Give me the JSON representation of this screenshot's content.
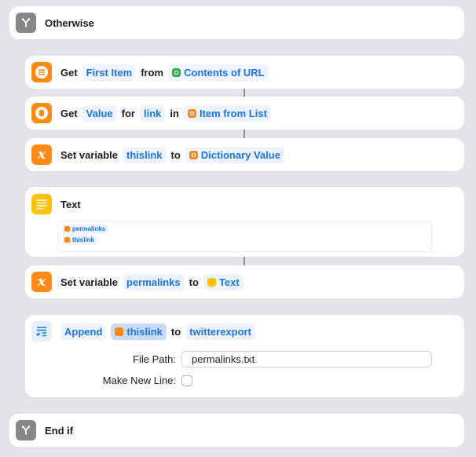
{
  "otherwise": {
    "label": "Otherwise",
    "icon": "branch-icon"
  },
  "actions": [
    {
      "icon": "list-icon",
      "parts": [
        {
          "type": "word",
          "text": "Get"
        },
        {
          "type": "token",
          "text": "First Item"
        },
        {
          "type": "word",
          "text": "from"
        },
        {
          "type": "token",
          "text": "Contents of URL",
          "icon": "url-icon",
          "icon_color": "#2fb24c"
        }
      ]
    },
    {
      "icon": "dictionary-icon",
      "parts": [
        {
          "type": "word",
          "text": "Get"
        },
        {
          "type": "token",
          "text": "Value"
        },
        {
          "type": "word",
          "text": "for"
        },
        {
          "type": "token",
          "text": "link"
        },
        {
          "type": "word",
          "text": "in"
        },
        {
          "type": "token",
          "text": "Item from List",
          "icon": "list-variable-icon",
          "icon_color": "#fd8a14"
        }
      ]
    },
    {
      "icon": "variable-icon",
      "parts": [
        {
          "type": "word",
          "text": "Set variable"
        },
        {
          "type": "token",
          "text": "thislink"
        },
        {
          "type": "word",
          "text": "to"
        },
        {
          "type": "token",
          "text": "Dictionary Value",
          "icon": "dictionary-variable-icon",
          "icon_color": "#fd8a14"
        }
      ]
    }
  ],
  "text_action": {
    "label": "Text",
    "icon": "text-icon",
    "tokens": [
      "permalinks",
      "thislink"
    ]
  },
  "set_permalinks": {
    "parts": [
      {
        "type": "word",
        "text": "Set variable"
      },
      {
        "type": "token",
        "text": "permalinks"
      },
      {
        "type": "word",
        "text": "to"
      },
      {
        "type": "token",
        "text": "Text",
        "icon": "text-variable-icon",
        "icon_color": "#fec107"
      }
    ]
  },
  "append_action": {
    "icon": "append-icon",
    "verb": "Append",
    "variable": "thislink",
    "to": "to",
    "target": "twitterexport",
    "file_path_label": "File Path:",
    "file_path_value": "permalinks.txt",
    "make_new_line_label": "Make New Line:",
    "make_new_line_checked": false
  },
  "end_if": {
    "label": "End if",
    "icon": "branch-icon"
  },
  "colors": {
    "background": "#e3e3e9",
    "accent": "#1a73e8",
    "orange": "#fd8a14",
    "yellow": "#fec107",
    "green": "#2fb24c",
    "gray": "#86868b"
  }
}
